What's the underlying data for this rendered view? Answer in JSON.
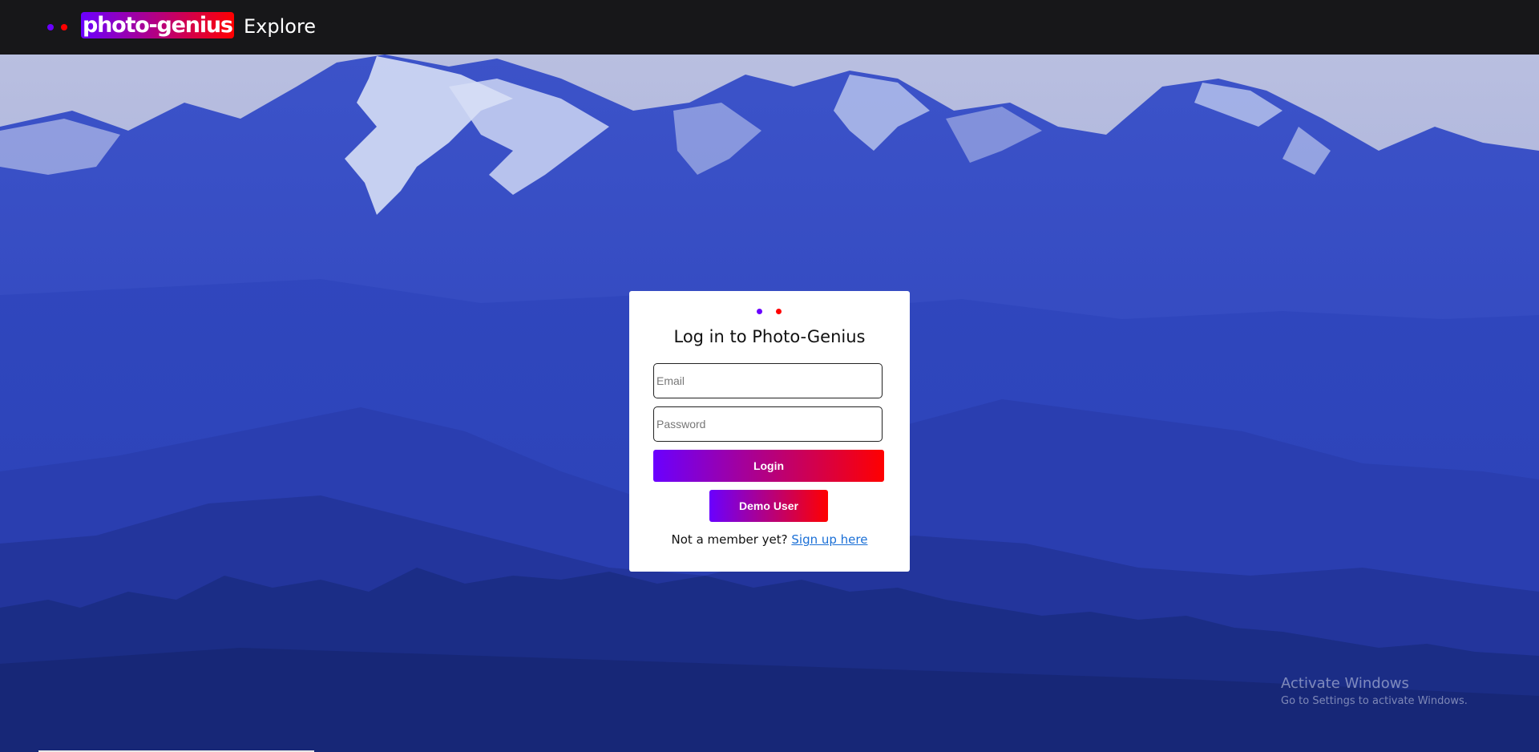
{
  "nav": {
    "brand": "photo-genius",
    "explore_label": "Explore"
  },
  "login": {
    "title": "Log in to Photo-Genius",
    "email_placeholder": "Email",
    "password_placeholder": "Password",
    "login_label": "Login",
    "demo_label": "Demo User",
    "signup_prompt": "Not a member yet?",
    "signup_link": "Sign up here"
  },
  "watermark": {
    "title": "Activate Windows",
    "subtitle": "Go to Settings to activate Windows."
  },
  "colors": {
    "gradient_start": "#6a00ff",
    "gradient_end": "#ff0000",
    "nav_background": "#171719",
    "link": "#1a6fd6"
  },
  "icons": {
    "logo_dots": "purple-dot, red-dot"
  }
}
